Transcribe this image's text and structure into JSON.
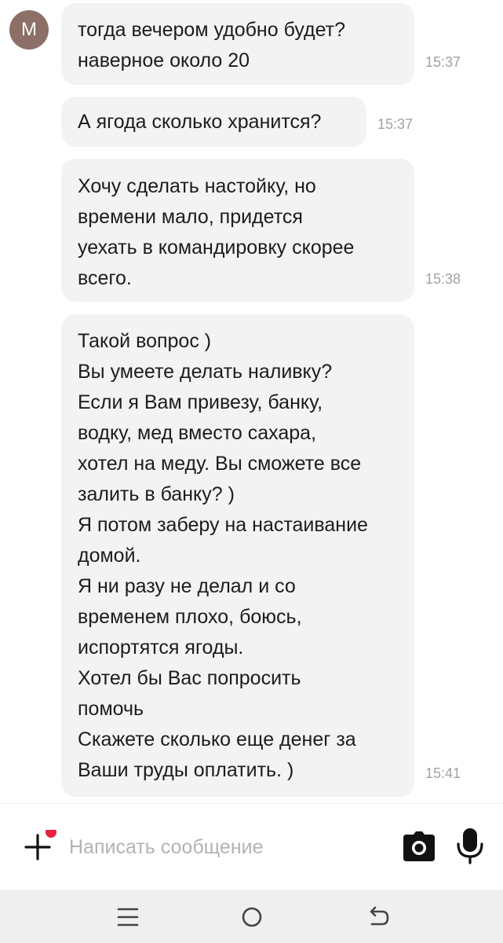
{
  "contact": {
    "avatar_letter": "M"
  },
  "messages": [
    {
      "text": "тогда вечером удобно будет?\nнаверное около 20",
      "time": "15:37"
    },
    {
      "text": "А ягода сколько хранится?",
      "time": "15:37"
    },
    {
      "text": "Хочу сделать настойку, но\nвремени мало, придется\nуехать в командировку скорее\nвсего.",
      "time": "15:38"
    },
    {
      "text": "Такой вопрос )\nВы умеете делать наливку?\nЕсли я Вам привезу, банку,\nводку, мед вместо сахара,\nхотел на меду. Вы сможете все\nзалить в банку? )\nЯ потом заберу на настаивание\nдомой.\nЯ ни разу не делал и со\nвременем плохо, боюсь,\nиспортятся ягоды.\nХотел бы Вас попросить\nпомочь\nСкажете сколько еще денег за\nВаши труды оплатить. )",
      "time": "15:41"
    }
  ],
  "composer": {
    "placeholder": "Написать сообщение",
    "value": "",
    "plus_icon": "plus-icon",
    "notification_dot_color": "#e8233e",
    "camera_icon": "camera-icon",
    "mic_icon": "microphone-icon"
  },
  "navbar": {
    "icons": [
      "menu-icon",
      "home-circle-icon",
      "back-icon"
    ]
  },
  "colors": {
    "bubble": "#f3f3f3",
    "avatar": "#8c6f66",
    "timestamp": "#a2a2a2",
    "navbar": "#efefef"
  }
}
